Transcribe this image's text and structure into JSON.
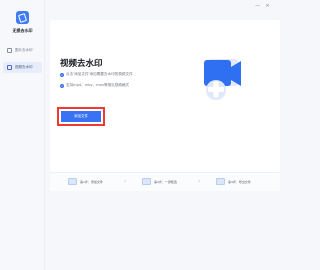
{
  "app": {
    "title": "无损去水印"
  },
  "sidebar": {
    "items": [
      {
        "label": "图片去水印",
        "icon": "image-icon",
        "active": false
      },
      {
        "label": "视频去水印",
        "icon": "video-icon",
        "active": true
      }
    ]
  },
  "window_controls": {
    "minimize": "—",
    "close": "×"
  },
  "main": {
    "title": "视频去水印",
    "bullets": [
      "点击'添加文件'添加需要去水印的视频文件",
      "支持mp4、mkv、mov等常见视频格式"
    ],
    "add_button_label": "添加文件"
  },
  "steps": [
    {
      "label": "第1步：添加文件",
      "sub": ""
    },
    {
      "label": "第2步：一键框选",
      "sub": ""
    },
    {
      "label": "第3步：导出文件",
      "sub": ""
    }
  ],
  "colors": {
    "accent": "#3973f4",
    "highlight_border": "#f03a31",
    "sidebar_active": "#e7edfb"
  }
}
